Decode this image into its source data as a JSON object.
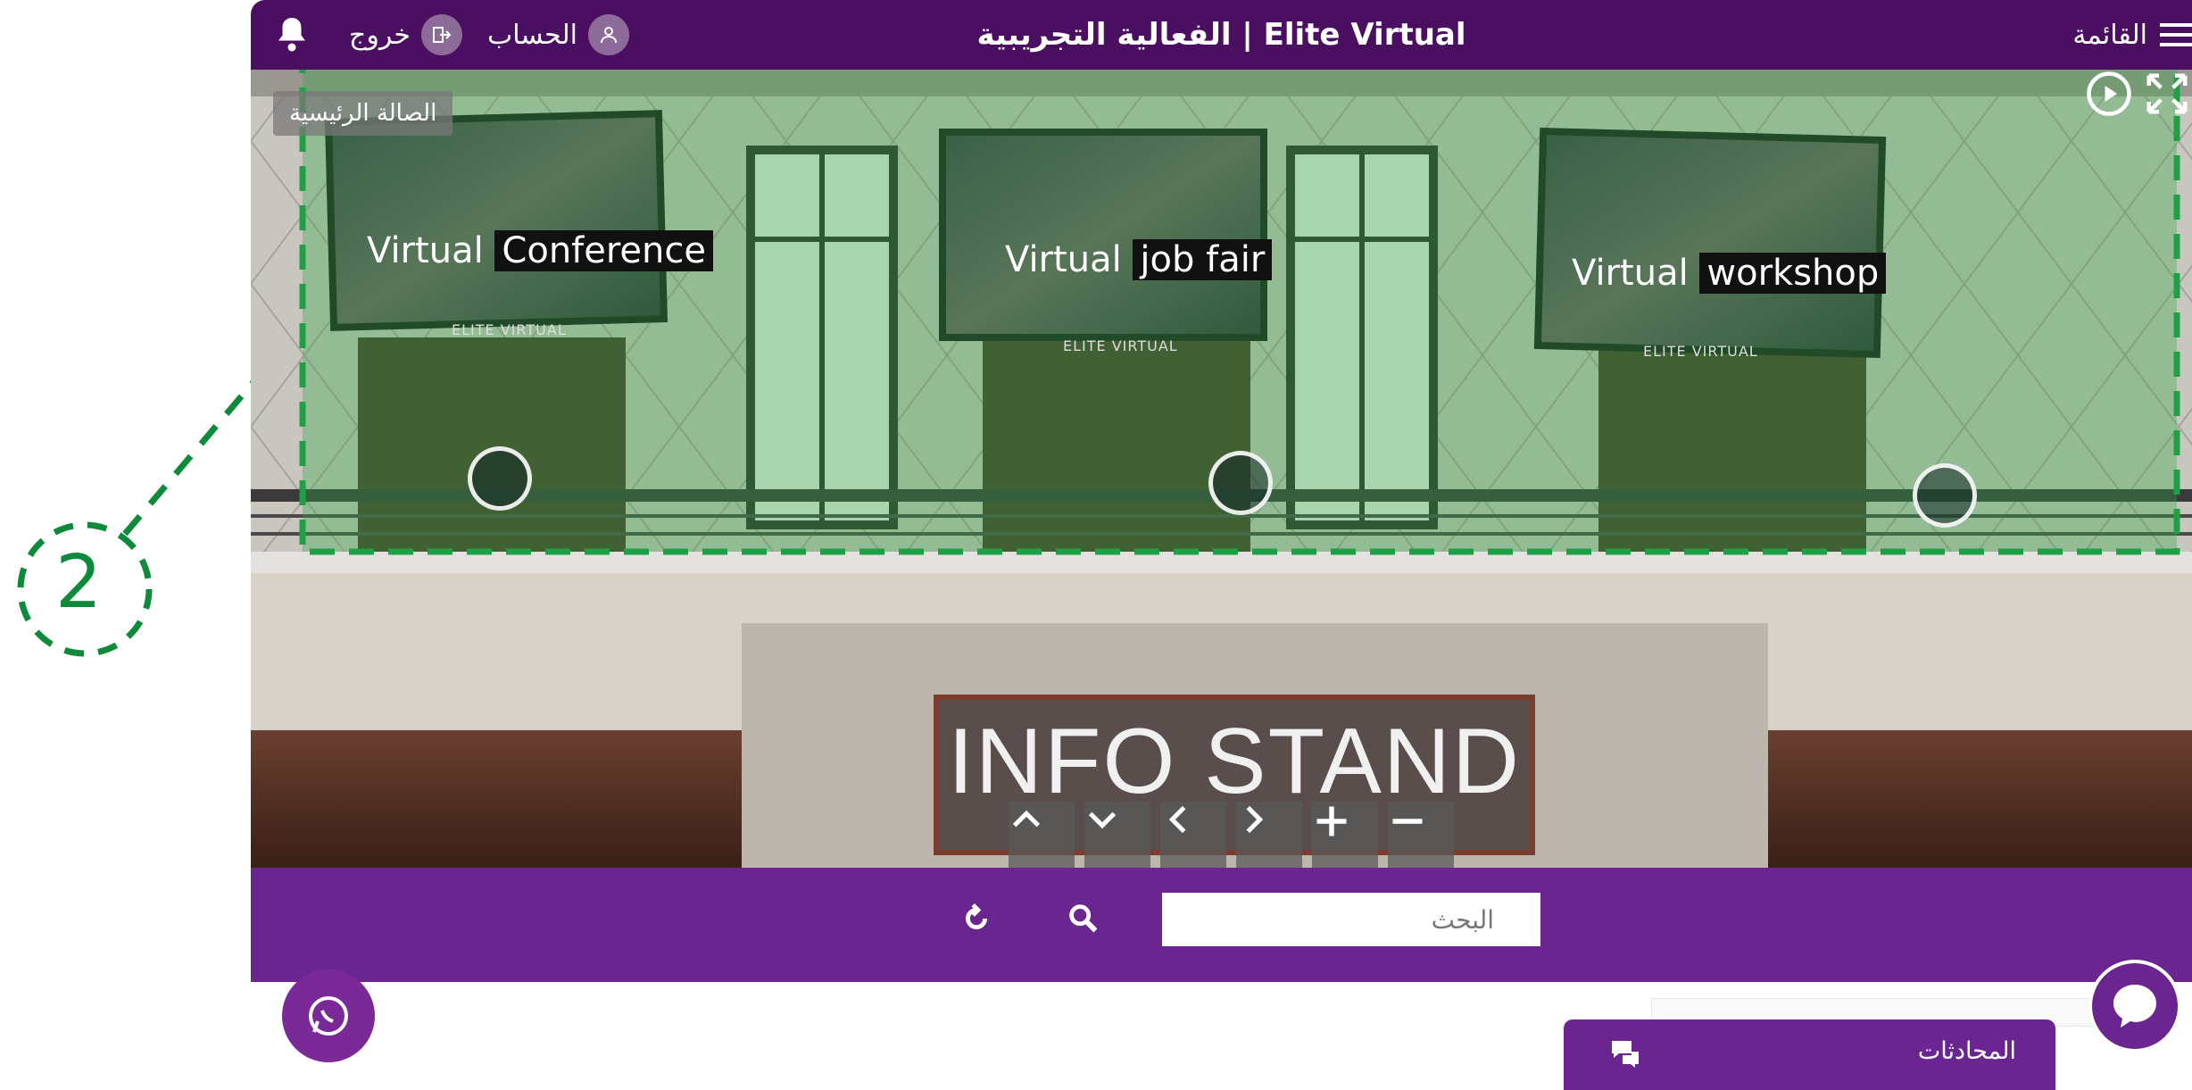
{
  "topbar": {
    "title": "الفعالية التجريبية | Elite Virtual",
    "logout_label": "خروج",
    "account_label": "الحساب",
    "menu_label": "القائمة",
    "notification_icon": "bell-icon",
    "logout_icon": "logout-icon",
    "account_icon": "user-icon",
    "menu_icon": "hamburger-icon",
    "bar_color": "#4b0f62"
  },
  "scene": {
    "hall_label": "الصالة الرئيسية",
    "autoplay_icon": "play-circle-icon",
    "fullscreen_icon": "expand-icon",
    "screens": [
      {
        "title_plain": "Virtual",
        "title_highlight": "Conference",
        "brand": "ELITE VIRTUAL"
      },
      {
        "title_plain": "Virtual",
        "title_highlight": "job fair",
        "brand": "ELITE VIRTUAL"
      },
      {
        "title_plain": "Virtual",
        "title_highlight": "workshop",
        "brand": "ELITE VIRTUAL"
      }
    ],
    "info_stand_label": "INFO STAND",
    "controls": {
      "up": "^",
      "down": "v",
      "left": "<",
      "right": ">",
      "zoom_in": "+",
      "zoom_out": "−"
    }
  },
  "search": {
    "placeholder": "البحث",
    "search_icon": "search-icon",
    "reset_icon": "refresh-icon",
    "bar_color": "#6b2590"
  },
  "annotation": {
    "number": "2",
    "color": "#0e8a3b"
  },
  "chat": {
    "panel_label": "المحادثات",
    "panel_icon": "chat-bubbles-icon",
    "fab_icon": "chat-icon",
    "whatsapp_icon": "whatsapp-icon"
  }
}
